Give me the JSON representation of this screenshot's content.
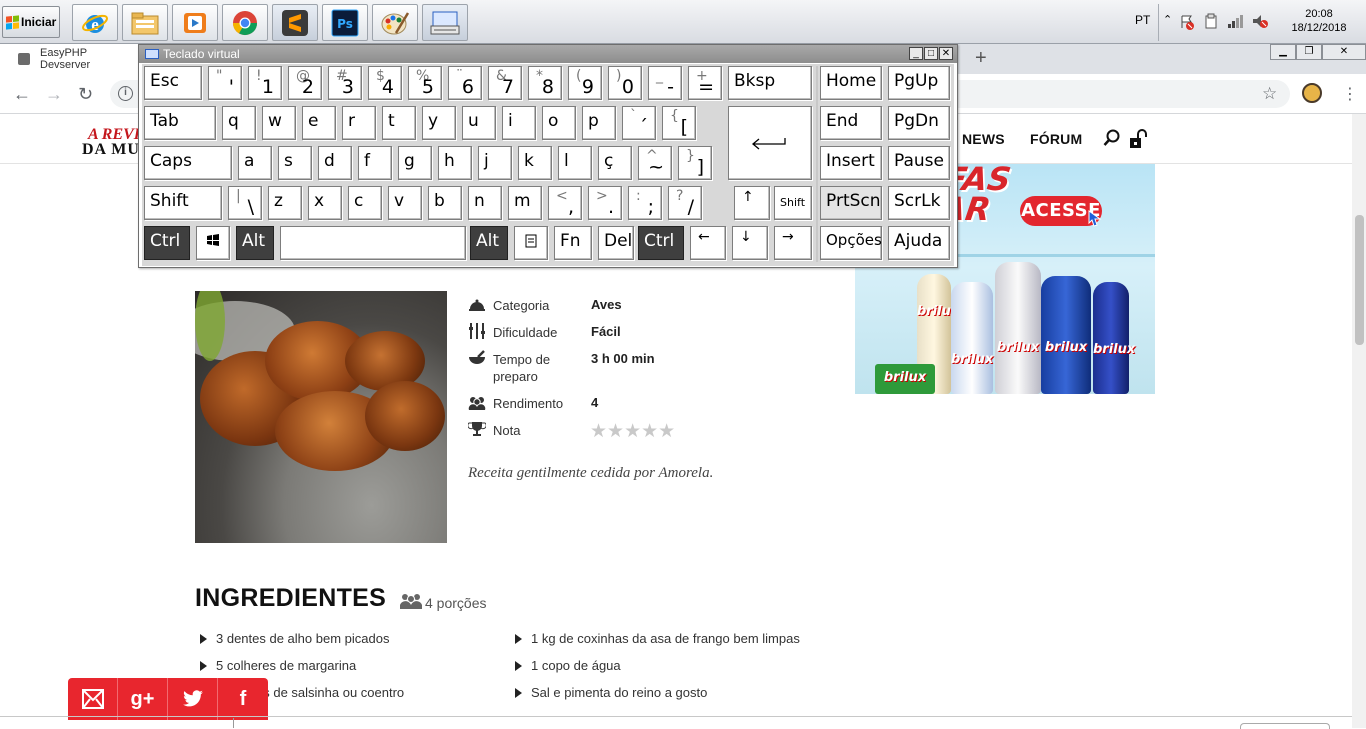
{
  "taskbar": {
    "start_label": "Iniciar",
    "apps": [
      "internet-explorer",
      "file-explorer",
      "media-player",
      "chrome",
      "sublime-text",
      "photoshop",
      "paint",
      "osk"
    ],
    "lang": "PT",
    "time": "20:08",
    "date": "18/12/2018"
  },
  "browser": {
    "tab_title": "EasyPHP Devserver",
    "new_tab": "+"
  },
  "site": {
    "logo_line1": "A REVI",
    "logo_line2": "DA MUL",
    "menu": [
      "NEWS",
      "FÓRUM"
    ]
  },
  "ad": {
    "headline": "FAS\nAR",
    "button": "ACESSE",
    "brand": "brilux"
  },
  "recipe": {
    "info": [
      {
        "label": "Categoria",
        "value": "Aves",
        "icon": "cloche-icon"
      },
      {
        "label": "Dificuldade",
        "value": "Fácil",
        "icon": "utensils-icon"
      },
      {
        "label": "Tempo de preparo",
        "value": "3 h 00 min",
        "icon": "mortar-icon"
      },
      {
        "label": "Rendimento",
        "value": "4",
        "icon": "people-icon"
      },
      {
        "label": "Nota",
        "value": "",
        "icon": "trophy-icon"
      }
    ],
    "rating": {
      "stars_filled": 0,
      "stars_total": 5,
      "stars_text": "★★★★★"
    },
    "credit": "Receita gentilmente cedida por Amorela.",
    "ingredients_title": "INGREDIENTES",
    "portions": "4 porções",
    "ingredients_left": [
      "3 dentes de alho bem picados",
      "5  colheres de margarina",
      "es de salsinha ou coentro"
    ],
    "ingredients_right": [
      "1 kg de coxinhas da asa de frango bem limpas",
      "1 copo de água",
      "Sal e pimenta do reino a gosto"
    ]
  },
  "share": [
    "email",
    "g+",
    "twitter",
    "f"
  ],
  "osk": {
    "title": "Teclado virtual",
    "keys": {
      "esc": "Esc",
      "bksp": "Bksp",
      "tab": "Tab",
      "caps": "Caps",
      "shift": "Shift",
      "shift_r": "Shift",
      "ctrl": "Ctrl",
      "alt": "Alt",
      "altgr": "Alt",
      "fn": "Fn",
      "del": "Del",
      "ctrl_r": "Ctrl",
      "home": "Home",
      "pgup": "PgUp",
      "end": "End",
      "pgdn": "PgDn",
      "insert": "Insert",
      "pause": "Pause",
      "prtscn": "PrtScn",
      "scrlk": "ScrLk",
      "opcoes": "Opções",
      "ajuda": "Ajuda"
    },
    "row1": [
      [
        "\"",
        "'"
      ],
      [
        "!",
        "1"
      ],
      [
        "@",
        "2"
      ],
      [
        "#",
        "3"
      ],
      [
        "$",
        "4"
      ],
      [
        "%",
        "5"
      ],
      [
        "¨",
        "6"
      ],
      [
        "&",
        "7"
      ],
      [
        "*",
        "8"
      ],
      [
        "(",
        "9"
      ],
      [
        ")",
        "0"
      ],
      [
        "_",
        "-"
      ],
      [
        "+",
        "="
      ]
    ],
    "row2": [
      "q",
      "w",
      "e",
      "r",
      "t",
      "y",
      "u",
      "i",
      "o",
      "p"
    ],
    "row2_sym": [
      [
        "`",
        "´"
      ],
      [
        "{",
        "["
      ]
    ],
    "row3": [
      "a",
      "s",
      "d",
      "f",
      "g",
      "h",
      "j",
      "k",
      "l",
      "ç"
    ],
    "row3_sym": [
      [
        "^",
        "~"
      ],
      [
        "}",
        "]"
      ]
    ],
    "row4": [
      "z",
      "x",
      "c",
      "v",
      "b",
      "n",
      "m"
    ],
    "row4_sym": [
      [
        "|",
        "\\"
      ],
      [
        "<",
        ","
      ],
      [
        ">",
        "."
      ],
      [
        ":",
        ";"
      ],
      [
        "?",
        "/"
      ]
    ],
    "arrows": {
      "up": "↑",
      "down": "↓",
      "left": "←",
      "right": "→"
    }
  }
}
